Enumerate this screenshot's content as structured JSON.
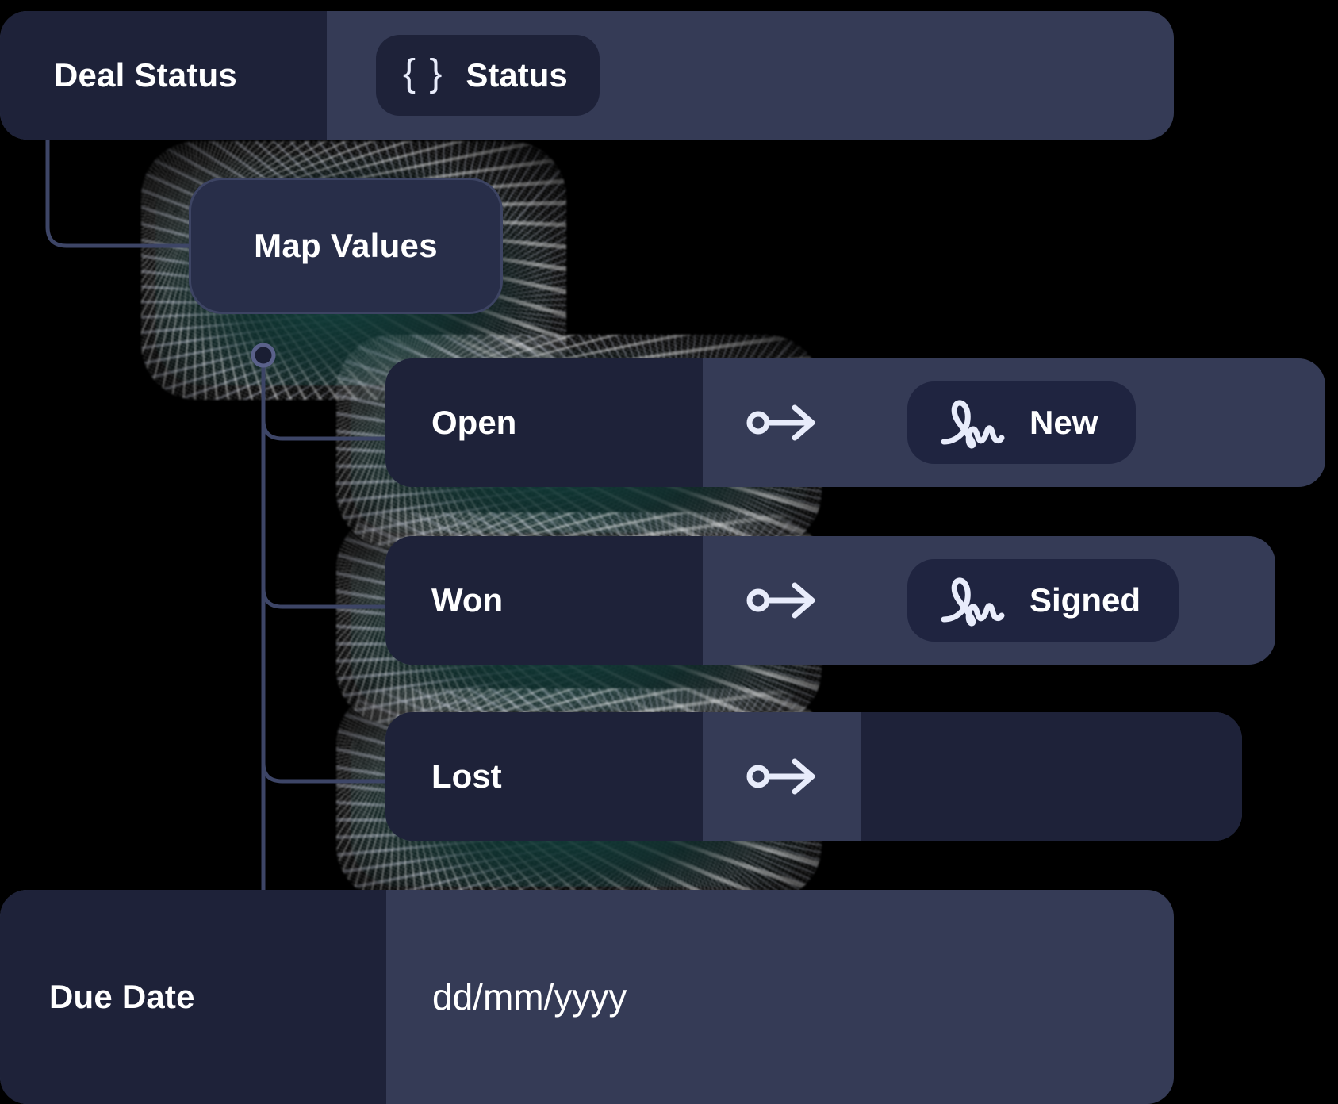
{
  "theme": {
    "background": "#000000",
    "surface_light": "#353b56",
    "surface_dark": "#1e2239",
    "pill_dark": "#1f2440",
    "text": "#ffffff",
    "icon": "#e8ecfb",
    "connector": "#3d4566",
    "glow": "#11423e"
  },
  "deal_status_row": {
    "label": "Deal Status",
    "token": {
      "icon": "curly-braces-icon",
      "icon_glyph": "{ }",
      "text": "Status"
    }
  },
  "map_values_node": {
    "label": "Map Values"
  },
  "mappings": {
    "arrow_icon": "maps-to-arrow-icon",
    "rows": [
      {
        "source": "Open",
        "target": "New",
        "target_icon": "signature-icon",
        "has_target": true
      },
      {
        "source": "Won",
        "target": "Signed",
        "target_icon": "signature-icon",
        "has_target": true
      },
      {
        "source": "Lost",
        "target": "",
        "target_icon": "",
        "has_target": false
      }
    ]
  },
  "due_date_row": {
    "label": "Due Date",
    "placeholder": "dd/mm/yyyy",
    "value": "dd/mm/yyyy"
  }
}
